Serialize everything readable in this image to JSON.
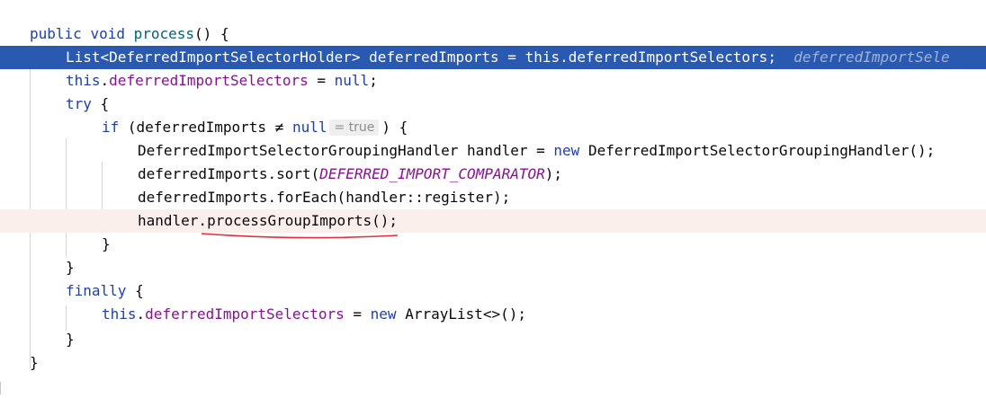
{
  "editor": {
    "language": "Java",
    "lines": [
      {
        "id": "L1",
        "text_a": "public",
        "text_b": "void",
        "method": "process",
        "rest": "() {"
      },
      {
        "id": "L2",
        "type": "List<DeferredImportSelectorHolder>",
        "var": "deferredImports",
        "assign": "=",
        "self": "this",
        "field": "deferredImportSelectors",
        "end": ";",
        "hint": "deferredImportSele"
      },
      {
        "id": "L3",
        "self": "this",
        "field": "deferredImportSelectors",
        "assign": "=",
        "value": "null",
        "end": ";"
      },
      {
        "id": "L4",
        "kw": "try",
        "rest": "{"
      },
      {
        "id": "L5",
        "kw": "if",
        "open": "(deferredImports",
        "op": "≠",
        "value": "null",
        "hint": "= true",
        "close": ") {"
      },
      {
        "id": "L6",
        "text": "DeferredImportSelectorGroupingHandler handler =",
        "kw": "new",
        "rest": "DeferredImportSelectorGroupingHandler();"
      },
      {
        "id": "L7",
        "prefix": "deferredImports.sort(",
        "const": "DEFERRED_IMPORT_COMPARATOR",
        "suffix": ");"
      },
      {
        "id": "L8",
        "text": "deferredImports.forEach(handler::register);"
      },
      {
        "id": "L9",
        "prefix": "handler.",
        "call": "processGroupImports",
        "suffix": "();"
      },
      {
        "id": "L10",
        "text": "}"
      },
      {
        "id": "L11",
        "text": "}"
      },
      {
        "id": "L12",
        "kw": "finally",
        "rest": "{"
      },
      {
        "id": "L13",
        "self": "this",
        "field": "deferredImportSelectors",
        "assign": "=",
        "kw": "new",
        "rest": "ArrayList<>();"
      },
      {
        "id": "L14",
        "text": "}"
      },
      {
        "id": "L15",
        "text": "}"
      }
    ],
    "colors": {
      "keyword": "#1e3fa8",
      "field": "#871094",
      "method": "#00627a",
      "selection": "#2a59b1",
      "current_line": "#fbefec",
      "squiggle": "#e0303a"
    }
  }
}
